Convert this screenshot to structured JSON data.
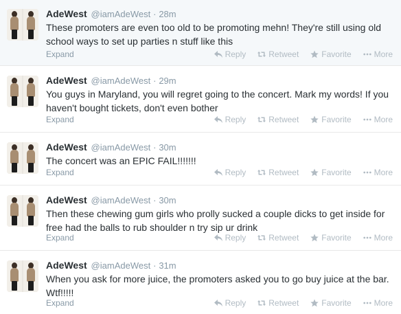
{
  "actions": {
    "reply": "Reply",
    "retweet": "Retweet",
    "favorite": "Favorite",
    "more": "More",
    "expand": "Expand"
  },
  "tweets": [
    {
      "name": "AdeWest",
      "handle": "@iamAdeWest",
      "separator": "·",
      "time": "28m",
      "text": "These promoters are even too old to be promoting mehn! They're still using old school ways to set up parties n stuff like this"
    },
    {
      "name": "AdeWest",
      "handle": "@iamAdeWest",
      "separator": "·",
      "time": "29m",
      "text": "You guys in Maryland, you will regret going to the concert. Mark my words! If you haven't bought tickets, don't even bother"
    },
    {
      "name": "AdeWest",
      "handle": "@iamAdeWest",
      "separator": "·",
      "time": "30m",
      "text": "The concert was an EPIC FAIL!!!!!!!"
    },
    {
      "name": "AdeWest",
      "handle": "@iamAdeWest",
      "separator": "·",
      "time": "30m",
      "text": "Then these chewing gum girls who prolly sucked a couple dicks to get inside for free had the balls to rub shoulder n try sip ur drink"
    },
    {
      "name": "AdeWest",
      "handle": "@iamAdeWest",
      "separator": "·",
      "time": "31m",
      "text": "When you ask for more juice, the promoters asked you to go buy juice at the bar. Wtf!!!!!"
    }
  ]
}
